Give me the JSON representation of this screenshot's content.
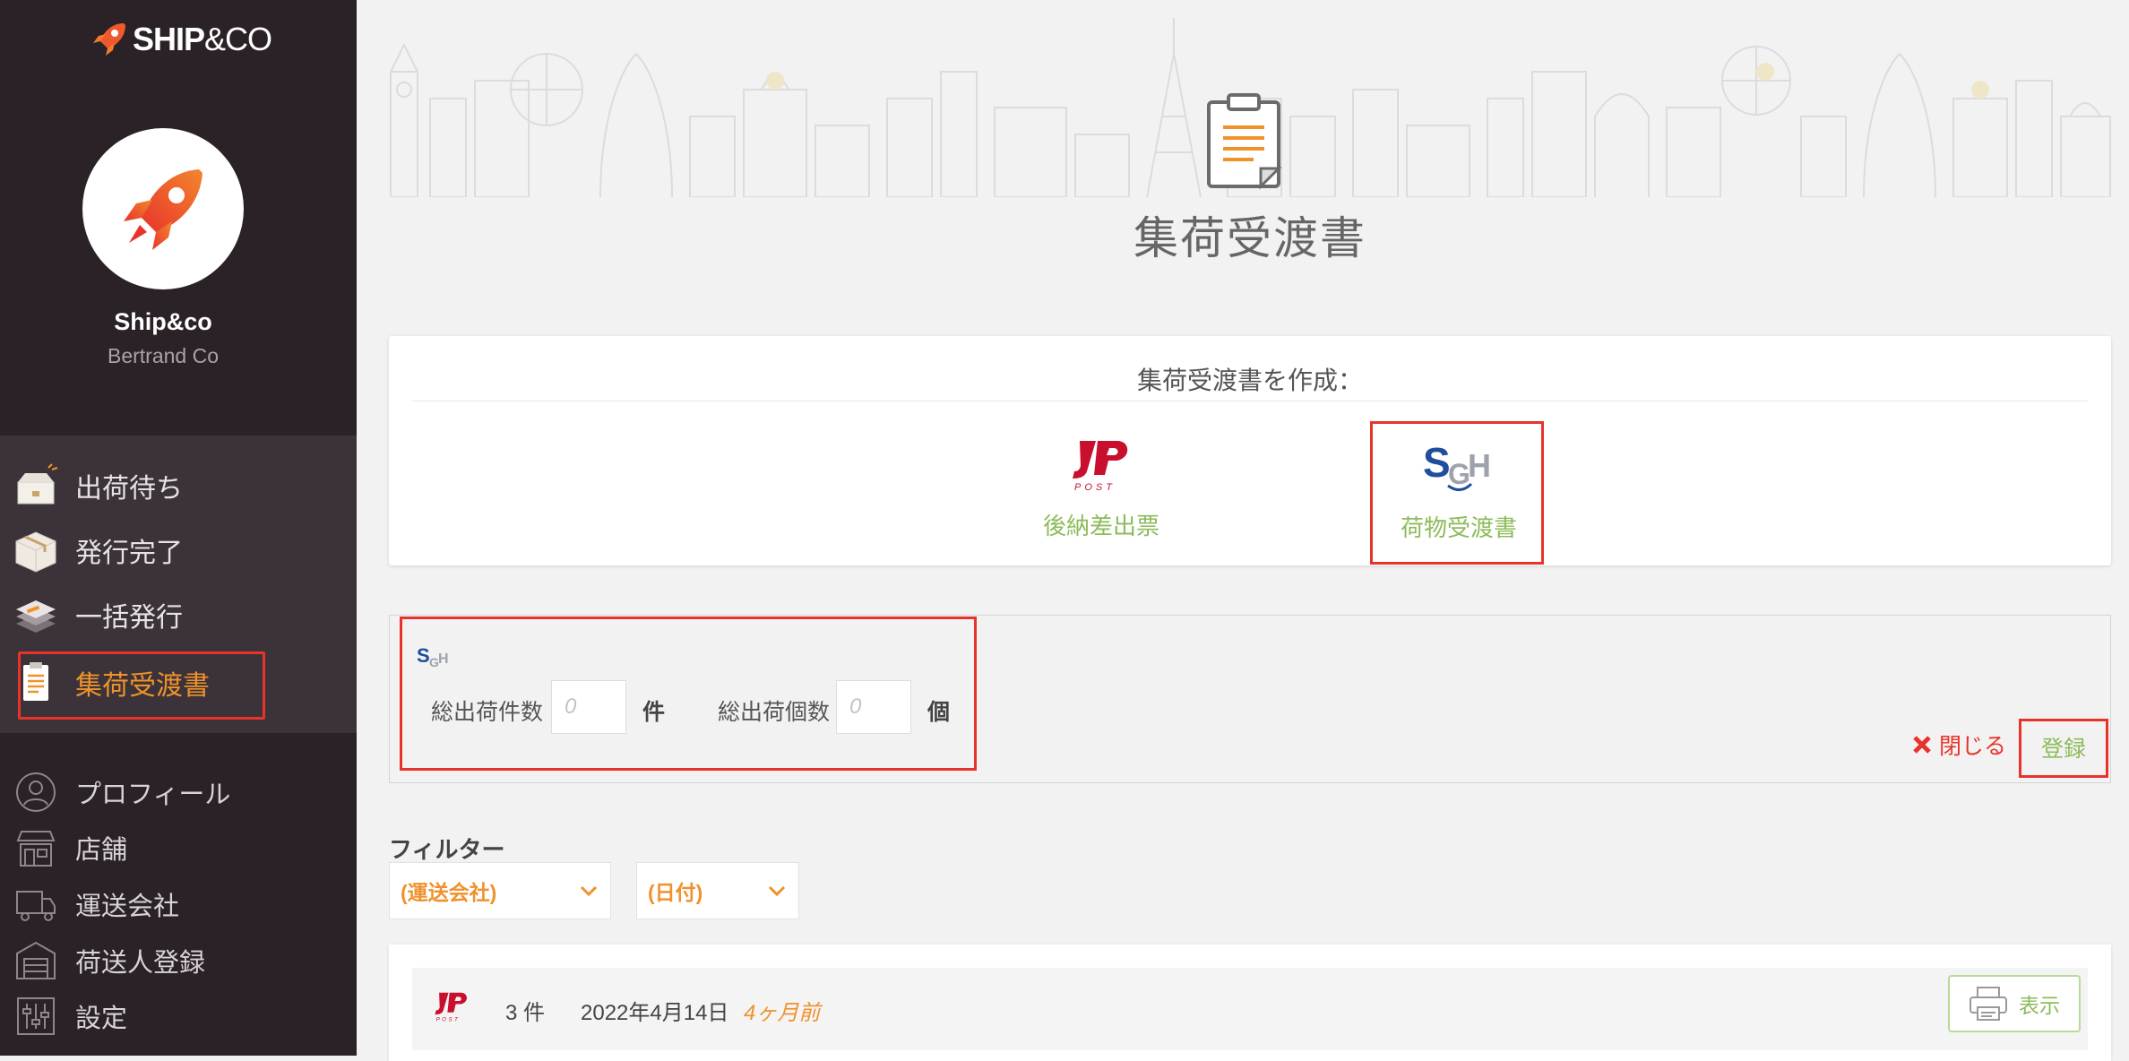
{
  "brand": {
    "bold": "SHIP",
    "light": "&CO"
  },
  "account": {
    "name": "Ship&co",
    "company": "Bertrand Co"
  },
  "nav": {
    "primary": [
      {
        "id": "awaiting",
        "label": "出荷待ち",
        "icon": "box-open-icon"
      },
      {
        "id": "issued",
        "label": "発行完了",
        "icon": "box-closed-icon"
      },
      {
        "id": "bulk",
        "label": "一括発行",
        "icon": "stack-icon"
      },
      {
        "id": "manifest",
        "label": "集荷受渡書",
        "icon": "clipboard-icon",
        "active": true
      }
    ],
    "secondary": [
      {
        "id": "profile",
        "label": "プロフィール",
        "icon": "user-icon"
      },
      {
        "id": "stores",
        "label": "店舗",
        "icon": "store-icon"
      },
      {
        "id": "carriers",
        "label": "運送会社",
        "icon": "truck-icon"
      },
      {
        "id": "senders",
        "label": "荷送人登録",
        "icon": "warehouse-icon"
      },
      {
        "id": "settings",
        "label": "設定",
        "icon": "sliders-icon"
      }
    ]
  },
  "page": {
    "title": "集荷受渡書"
  },
  "create": {
    "heading": "集荷受渡書を作成：",
    "options": [
      {
        "carrier": "JP POST",
        "label": "後納差出票"
      },
      {
        "carrier": "SGH",
        "label": "荷物受渡書"
      }
    ]
  },
  "form": {
    "carrier_logo": "SGH",
    "total_shipments_label": "総出荷件数",
    "total_shipments_value": "",
    "total_shipments_placeholder": "0",
    "total_shipments_unit": "件",
    "total_packages_label": "総出荷個数",
    "total_packages_value": "",
    "total_packages_placeholder": "0",
    "total_packages_unit": "個",
    "close_label": "閉じる",
    "register_label": "登録"
  },
  "filter": {
    "label": "フィルター",
    "carrier_selected": "(運送会社)",
    "date_selected": "(日付)"
  },
  "manifests": [
    {
      "carrier": "JP POST",
      "count": "3 件",
      "date": "2022年4月14日",
      "relative": "4ヶ月前",
      "action": "表示"
    }
  ],
  "colors": {
    "sidebar_bg": "#2a2227",
    "accent_orange": "#f0922c",
    "accent_green": "#8dbb5b",
    "highlight_red": "#e8332a",
    "jp_post_red": "#c8102e",
    "sgh_blue": "#1f4e9c"
  }
}
